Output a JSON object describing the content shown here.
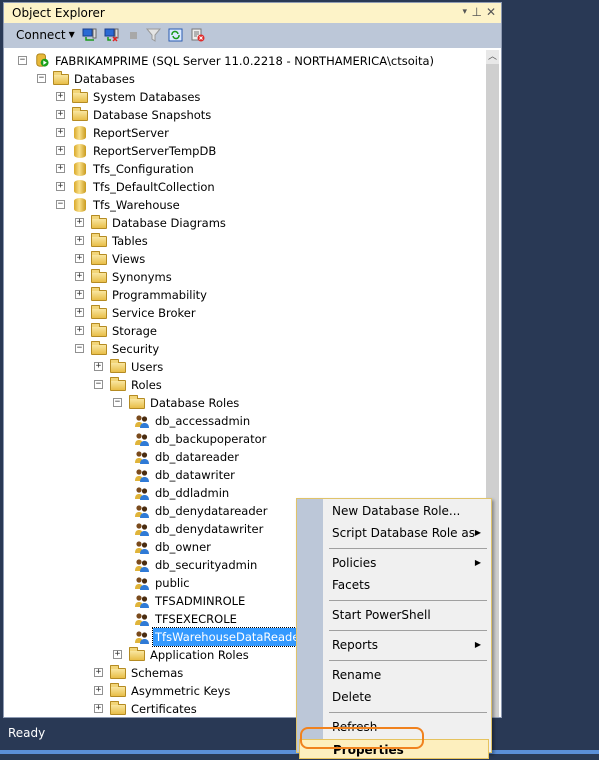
{
  "panel": {
    "title": "Object Explorer",
    "title_buttons": {
      "dropdown": "▾",
      "pin": "⊥",
      "close": "✕"
    }
  },
  "toolbar": {
    "connect_label": "Connect",
    "icons": [
      "connect-object-explorer-icon",
      "disconnect-icon",
      "stop-icon",
      "filter-icon",
      "refresh-icon",
      "new-query-cancel-icon"
    ]
  },
  "tree": [
    {
      "label": "FABRIKAMPRIME (SQL Server 11.0.2218 - NORTHAMERICA\\ctsoita)",
      "level": 0,
      "state": "expanded",
      "icon": "server"
    },
    {
      "label": "Databases",
      "level": 1,
      "state": "expanded",
      "icon": "folder"
    },
    {
      "label": "System Databases",
      "level": 2,
      "state": "collapsed",
      "icon": "folder"
    },
    {
      "label": "Database Snapshots",
      "level": 2,
      "state": "collapsed",
      "icon": "folder"
    },
    {
      "label": "ReportServer",
      "level": 2,
      "state": "collapsed",
      "icon": "database"
    },
    {
      "label": "ReportServerTempDB",
      "level": 2,
      "state": "collapsed",
      "icon": "database"
    },
    {
      "label": "Tfs_Configuration",
      "level": 2,
      "state": "collapsed",
      "icon": "database"
    },
    {
      "label": "Tfs_DefaultCollection",
      "level": 2,
      "state": "collapsed",
      "icon": "database"
    },
    {
      "label": "Tfs_Warehouse",
      "level": 2,
      "state": "expanded",
      "icon": "database"
    },
    {
      "label": "Database Diagrams",
      "level": 3,
      "state": "collapsed",
      "icon": "folder"
    },
    {
      "label": "Tables",
      "level": 3,
      "state": "collapsed",
      "icon": "folder"
    },
    {
      "label": "Views",
      "level": 3,
      "state": "collapsed",
      "icon": "folder"
    },
    {
      "label": "Synonyms",
      "level": 3,
      "state": "collapsed",
      "icon": "folder"
    },
    {
      "label": "Programmability",
      "level": 3,
      "state": "collapsed",
      "icon": "folder"
    },
    {
      "label": "Service Broker",
      "level": 3,
      "state": "collapsed",
      "icon": "folder"
    },
    {
      "label": "Storage",
      "level": 3,
      "state": "collapsed",
      "icon": "folder"
    },
    {
      "label": "Security",
      "level": 3,
      "state": "expanded",
      "icon": "folder"
    },
    {
      "label": "Users",
      "level": 4,
      "state": "collapsed",
      "icon": "folder"
    },
    {
      "label": "Roles",
      "level": 4,
      "state": "expanded",
      "icon": "folder"
    },
    {
      "label": "Database Roles",
      "level": 5,
      "state": "expanded",
      "icon": "folder"
    },
    {
      "label": "db_accessadmin",
      "level": 6,
      "state": "leaf",
      "icon": "role"
    },
    {
      "label": "db_backupoperator",
      "level": 6,
      "state": "leaf",
      "icon": "role"
    },
    {
      "label": "db_datareader",
      "level": 6,
      "state": "leaf",
      "icon": "role"
    },
    {
      "label": "db_datawriter",
      "level": 6,
      "state": "leaf",
      "icon": "role"
    },
    {
      "label": "db_ddladmin",
      "level": 6,
      "state": "leaf",
      "icon": "role"
    },
    {
      "label": "db_denydatareader",
      "level": 6,
      "state": "leaf",
      "icon": "role"
    },
    {
      "label": "db_denydatawriter",
      "level": 6,
      "state": "leaf",
      "icon": "role"
    },
    {
      "label": "db_owner",
      "level": 6,
      "state": "leaf",
      "icon": "role"
    },
    {
      "label": "db_securityadmin",
      "level": 6,
      "state": "leaf",
      "icon": "role"
    },
    {
      "label": "public",
      "level": 6,
      "state": "leaf",
      "icon": "role"
    },
    {
      "label": "TFSADMINROLE",
      "level": 6,
      "state": "leaf",
      "icon": "role"
    },
    {
      "label": "TFSEXECROLE",
      "level": 6,
      "state": "leaf",
      "icon": "role"
    },
    {
      "label": "TfsWarehouseDataReader",
      "level": 6,
      "state": "leaf",
      "icon": "role",
      "selected": true
    },
    {
      "label": "Application Roles",
      "level": 5,
      "state": "collapsed",
      "icon": "folder"
    },
    {
      "label": "Schemas",
      "level": 4,
      "state": "collapsed",
      "icon": "folder"
    },
    {
      "label": "Asymmetric Keys",
      "level": 4,
      "state": "collapsed",
      "icon": "folder"
    },
    {
      "label": "Certificates",
      "level": 4,
      "state": "collapsed",
      "icon": "folder"
    }
  ],
  "context_menu": {
    "items": [
      {
        "label": "New Database Role...",
        "submenu": false
      },
      {
        "label": "Script Database Role as",
        "submenu": true
      },
      {
        "separator": true
      },
      {
        "label": "Policies",
        "submenu": true
      },
      {
        "label": "Facets",
        "submenu": false
      },
      {
        "separator": true
      },
      {
        "label": "Start PowerShell",
        "submenu": false
      },
      {
        "separator": true
      },
      {
        "label": "Reports",
        "submenu": true
      },
      {
        "separator": true
      },
      {
        "label": "Rename",
        "submenu": false
      },
      {
        "label": "Delete",
        "submenu": false
      },
      {
        "separator": true
      },
      {
        "label": "Refresh",
        "submenu": false
      },
      {
        "label": "Properties",
        "submenu": false,
        "highlighted": true
      }
    ]
  },
  "statusbar": {
    "text": "Ready"
  },
  "colors": {
    "accent_highlight": "#f0821e",
    "selection": "#3399ff",
    "chrome_dark": "#293955"
  }
}
